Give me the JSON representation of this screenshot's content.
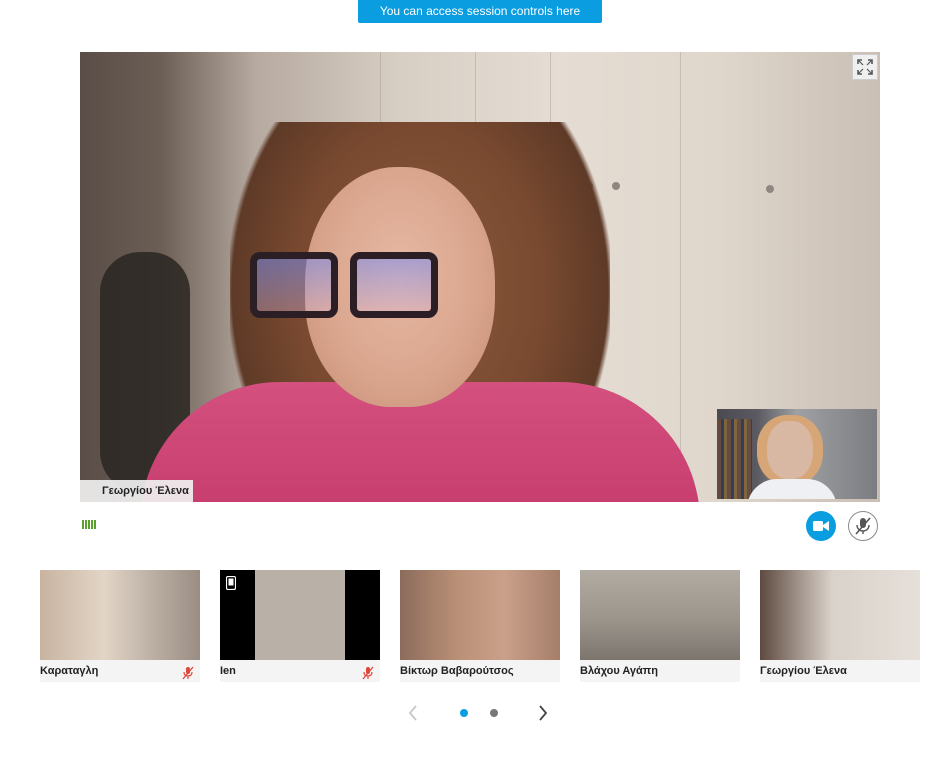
{
  "tooltip": {
    "text": "You can access session controls here"
  },
  "main_video": {
    "participant_name": "Γεωργίου Έλενα",
    "expand_icon": "expand-icon",
    "self_view_icon": "self-view"
  },
  "controls": {
    "signal_icon": "signal-bars-icon",
    "video_icon": "video-camera-icon",
    "mic_icon": "microphone-muted-icon"
  },
  "participants": [
    {
      "name": "Καραταγλη",
      "muted": true,
      "phone": false
    },
    {
      "name": "Ien",
      "muted": true,
      "phone": true
    },
    {
      "name": "Βίκτωρ Βαβαρούτσος",
      "muted": false,
      "phone": false
    },
    {
      "name": "Βλάχου Αγάπη",
      "muted": false,
      "phone": false
    },
    {
      "name": "Γεωργίου Έλενα",
      "muted": false,
      "phone": false
    }
  ],
  "pager": {
    "pages": 2,
    "current": 1
  },
  "colors": {
    "accent": "#0a9ee0",
    "muted_red": "#e0463a",
    "signal_green": "#5aa02c"
  }
}
